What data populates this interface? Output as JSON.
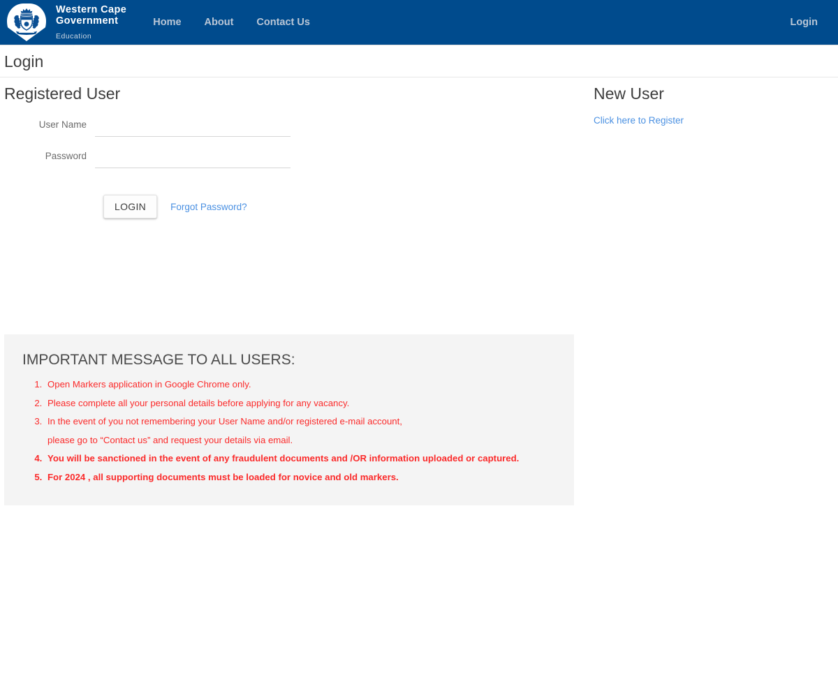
{
  "navbar": {
    "brand": {
      "line1": "Western Cape",
      "line2": "Government",
      "sub": "Education",
      "crest_icon": "coat-of-arms-icon"
    },
    "links": [
      {
        "label": "Home"
      },
      {
        "label": "About"
      },
      {
        "label": "Contact Us"
      }
    ],
    "right_links": [
      {
        "label": "Login"
      }
    ],
    "background_color": "#004b8d",
    "link_color": "#b9c6d6"
  },
  "page": {
    "title": "Login"
  },
  "registered_user": {
    "heading": "Registered User",
    "fields": [
      {
        "label": "User Name",
        "value": "",
        "placeholder": ""
      },
      {
        "label": "Password",
        "value": "",
        "placeholder": ""
      }
    ],
    "login_button": "LOGIN",
    "forgot_link": "Forgot Password?"
  },
  "new_user": {
    "heading": "New User",
    "register_link": "Click here to Register"
  },
  "notice": {
    "title": "IMPORTANT MESSAGE TO ALL USERS:",
    "text_color": "#fb2a2a",
    "background_color": "#f4f4f4",
    "items": [
      {
        "text": "Open Markers application in Google Chrome only.",
        "bold": false,
        "continuation": ""
      },
      {
        "text": "Please complete all your personal details before applying for any vacancy.",
        "bold": false,
        "continuation": ""
      },
      {
        "text": "In the event of you not remembering your User Name and/or registered e-mail account,",
        "bold": false,
        "continuation": "please go to “Contact us” and request your details via email."
      },
      {
        "text": "You will be sanctioned in the event of any fraudulent documents and /OR information uploaded or captured.",
        "bold": true,
        "continuation": ""
      },
      {
        "text": "For 2024 , all supporting documents must be loaded for novice and old markers.",
        "bold": true,
        "continuation": ""
      }
    ]
  },
  "colors": {
    "accent_blue": "#004b8d",
    "link_blue": "#4a90e2",
    "notice_red": "#fb2a2a",
    "heading_gray": "#3d3d3d"
  }
}
